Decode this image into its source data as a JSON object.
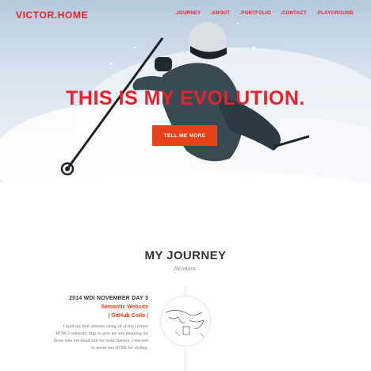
{
  "header": {
    "brand": "VICTOR.HOME",
    "nav": [
      ".JOURNEY",
      ".ABOUT",
      ".PORTFOLIO",
      ".CONTACT",
      ".PLAYGROUND"
    ]
  },
  "hero": {
    "headline": "THIS IS MY EVOLUTION.",
    "cta_label": "TELL ME MORE"
  },
  "journey": {
    "title": "MY JOURNEY",
    "subtitle": "Iteration.",
    "entry": {
      "date": "2014 WDI NOVEMBER DAY 3",
      "link1": "Semantic Website",
      "link2": "| GitHub Code |",
      "body_lines": [
        "I built my first website using all of the correct",
        "HTML5 semantic tags to give my site meaning for",
        "those who are blind and for webcrawlers. I learned",
        "to never use HTML for styling."
      ]
    }
  },
  "colors": {
    "accent": "#e8212b",
    "button": "#e8421c",
    "heading": "#333333"
  }
}
